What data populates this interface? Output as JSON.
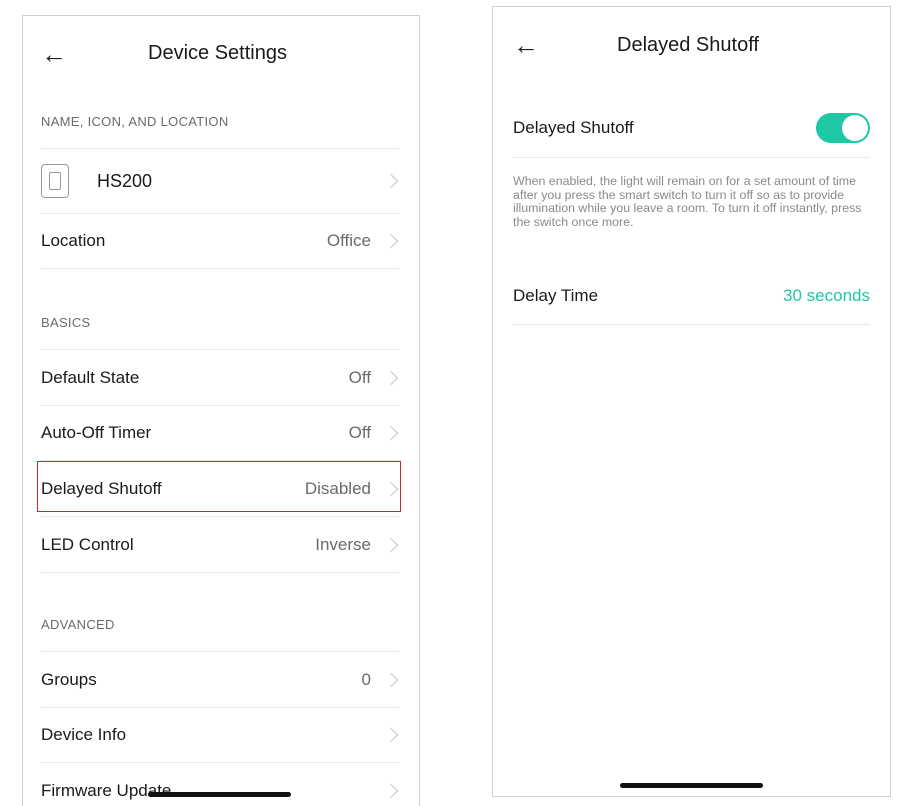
{
  "accent_color": "#1ec8a5",
  "left": {
    "back_icon": "back-arrow-icon",
    "title": "Device Settings",
    "section_name_icon_location": "NAME, ICON, AND LOCATION",
    "device_name": "HS200",
    "location_label": "Location",
    "location_value": "Office",
    "section_basics": "BASICS",
    "basics": [
      {
        "label": "Default State",
        "value": "Off"
      },
      {
        "label": "Auto-Off Timer",
        "value": "Off"
      },
      {
        "label": "Delayed Shutoff",
        "value": "Disabled"
      },
      {
        "label": "LED Control",
        "value": "Inverse"
      }
    ],
    "section_advanced": "ADVANCED",
    "advanced": [
      {
        "label": "Groups",
        "value": "0"
      },
      {
        "label": "Device Info",
        "value": ""
      },
      {
        "label": "Firmware Update",
        "value": ""
      }
    ]
  },
  "right": {
    "back_icon": "back-arrow-icon",
    "title": "Delayed Shutoff",
    "toggle_label": "Delayed Shutoff",
    "toggle_on": true,
    "description": "When enabled, the light will remain on for a set amount of time after you press the smart switch to turn it off so as to provide illumination while you leave a room. To turn it off instantly, press the switch once more.",
    "delay_label": "Delay Time",
    "delay_value": "30 seconds"
  }
}
